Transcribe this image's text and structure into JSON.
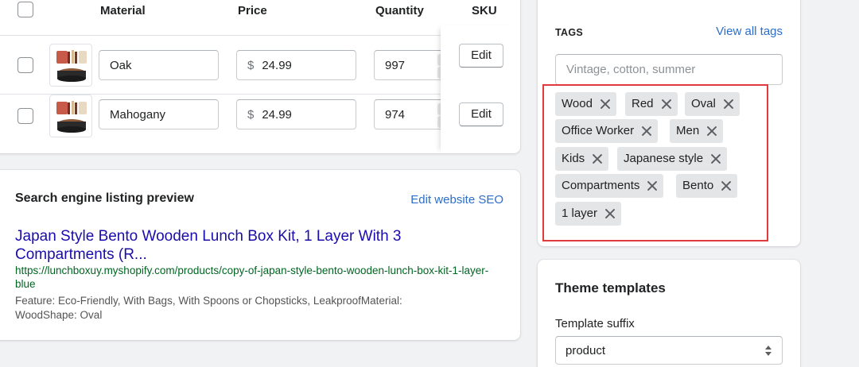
{
  "variants": {
    "columns": {
      "material": "Material",
      "price": "Price",
      "quantity": "Quantity",
      "sku": "SKU"
    },
    "rows": [
      {
        "material": "Oak",
        "currency": "$",
        "price": "24.99",
        "quantity": "997",
        "edit": "Edit"
      },
      {
        "material": "Mahogany",
        "currency": "$",
        "price": "24.99",
        "quantity": "974",
        "edit": "Edit"
      }
    ]
  },
  "seo": {
    "title": "Search engine listing preview",
    "edit_link": "Edit website SEO",
    "page_title": "Japan Style Bento Wooden Lunch Box Kit, 1 Layer With 3 Compartments (R...",
    "url": "https://lunchboxuy.myshopify.com/products/copy-of-japan-style-bento-wooden-lunch-box-kit-1-layer-blue",
    "description": "Feature: Eco-Friendly, With Bags, With Spoons or Chopsticks, LeakproofMaterial: WoodShape: Oval"
  },
  "tags": {
    "label": "TAGS",
    "view_all": "View all tags",
    "placeholder": "Vintage, cotton, summer",
    "items": [
      "Wood",
      "Red",
      "Oval",
      "Office Worker",
      "Men",
      "Kids",
      "Japanese style",
      "Compartments",
      "Bento",
      "1 layer"
    ]
  },
  "theme": {
    "title": "Theme templates",
    "suffix_label": "Template suffix",
    "suffix_value": "product"
  },
  "colors": {
    "link": "#2c6ecb",
    "seo_title": "#1a0dab",
    "seo_url": "#006621",
    "highlight": "#e0393e"
  }
}
